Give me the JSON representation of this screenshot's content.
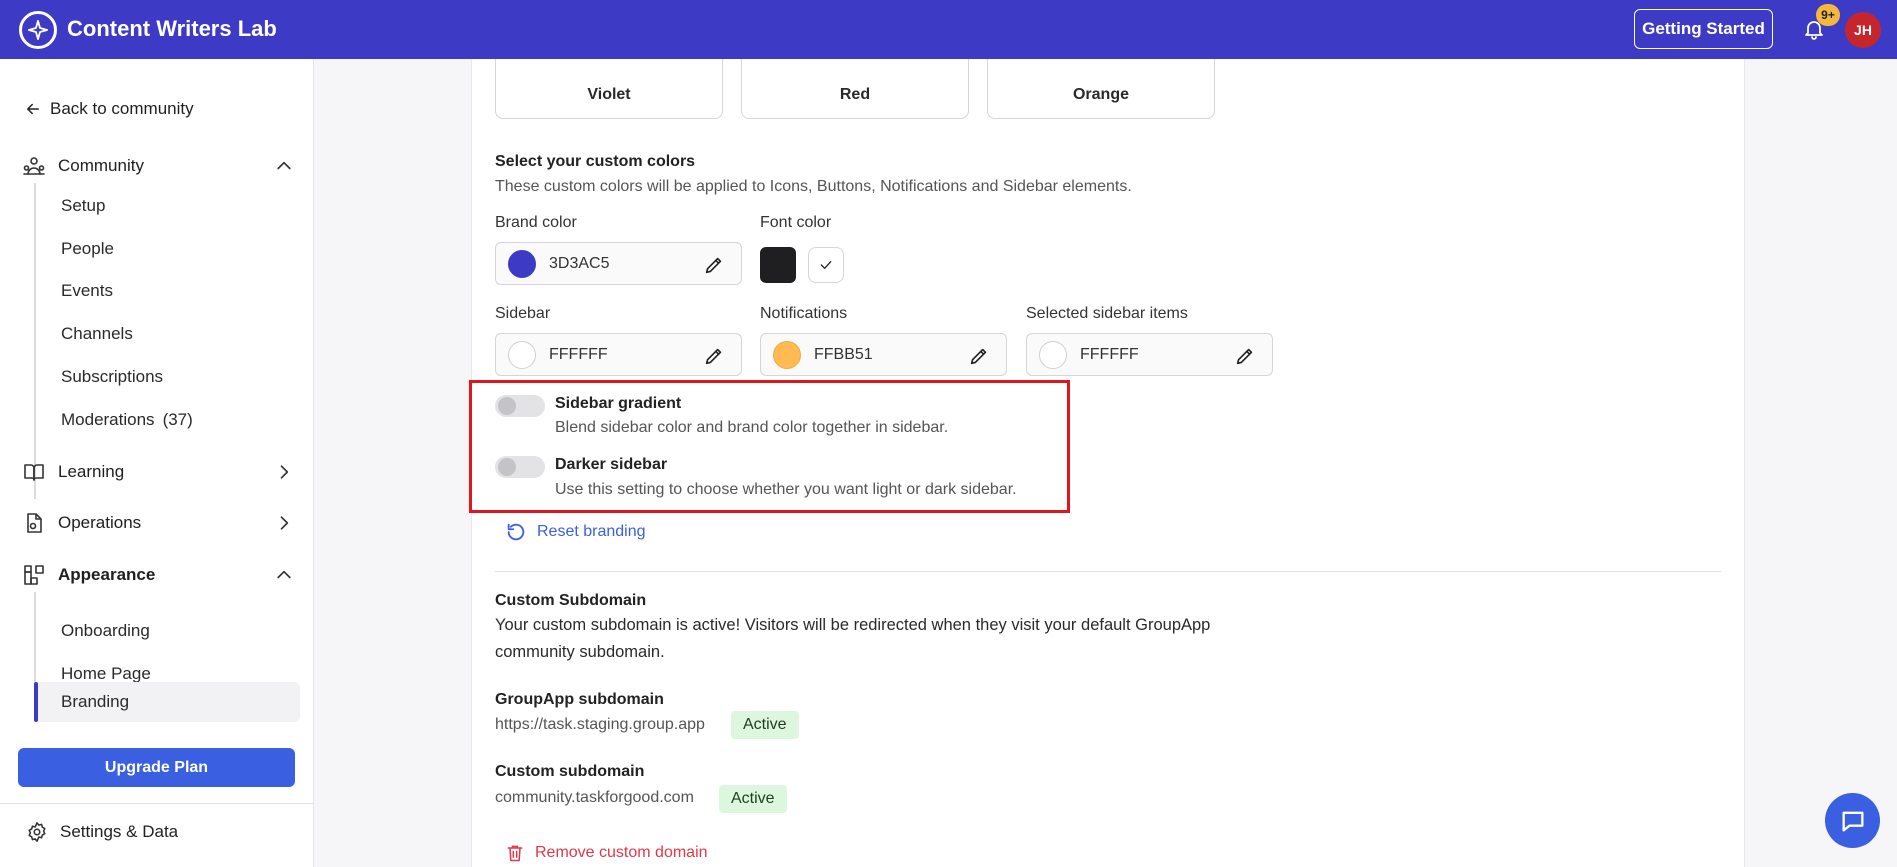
{
  "topbar": {
    "app_title": "Content Writers Lab",
    "getting_started_label": "Getting Started",
    "notification_badge": "9+",
    "avatar_initials": "JH",
    "brand_color": "#3d3ac5"
  },
  "sidebar": {
    "back_label": "Back to community",
    "sections": {
      "community": "Community",
      "learning": "Learning",
      "operations": "Operations",
      "appearance": "Appearance"
    },
    "community_items": [
      "Setup",
      "People",
      "Events",
      "Channels",
      "Subscriptions",
      "Moderations"
    ],
    "moderations_count": "(37)",
    "appearance_items": [
      "Onboarding",
      "Home Page",
      "Branding"
    ],
    "active_item": "Branding",
    "upgrade_label": "Upgrade Plan",
    "settings_label": "Settings & Data"
  },
  "color_tiles": [
    "Violet",
    "Red",
    "Orange"
  ],
  "custom_colors": {
    "title": "Select your custom colors",
    "description": "These custom colors will be applied to Icons, Buttons, Notifications and Sidebar elements.",
    "brand_label": "Brand color",
    "brand_hex": "3D3AC5",
    "font_label": "Font color",
    "sidebar_label": "Sidebar",
    "sidebar_hex": "FFFFFF",
    "notifications_label": "Notifications",
    "notifications_hex": "FFBB51",
    "selected_label": "Selected sidebar items",
    "selected_hex": "FFFFFF",
    "swatch_colors": {
      "brand": "#3D3AC5",
      "sidebar": "#FFFFFF",
      "notifications": "#FFBB51",
      "selected": "#FFFFFF"
    }
  },
  "toggles": {
    "gradient_title": "Sidebar gradient",
    "gradient_desc": "Blend sidebar color and brand color together in sidebar.",
    "gradient_on": false,
    "darker_title": "Darker sidebar",
    "darker_desc": "Use this setting to choose whether you want light or dark sidebar.",
    "darker_on": false
  },
  "reset_label": "Reset branding",
  "subdomain": {
    "title": "Custom Subdomain",
    "desc_line1": "Your custom subdomain is active! Visitors will be redirected when they visit your default GroupApp",
    "desc_line2": "community subdomain.",
    "groupapp_title": "GroupApp subdomain",
    "groupapp_url": "https://task.staging.group.app",
    "groupapp_status": "Active",
    "custom_title": "Custom subdomain",
    "custom_url": "community.taskforgood.com",
    "custom_status": "Active",
    "remove_label": "Remove custom domain"
  }
}
